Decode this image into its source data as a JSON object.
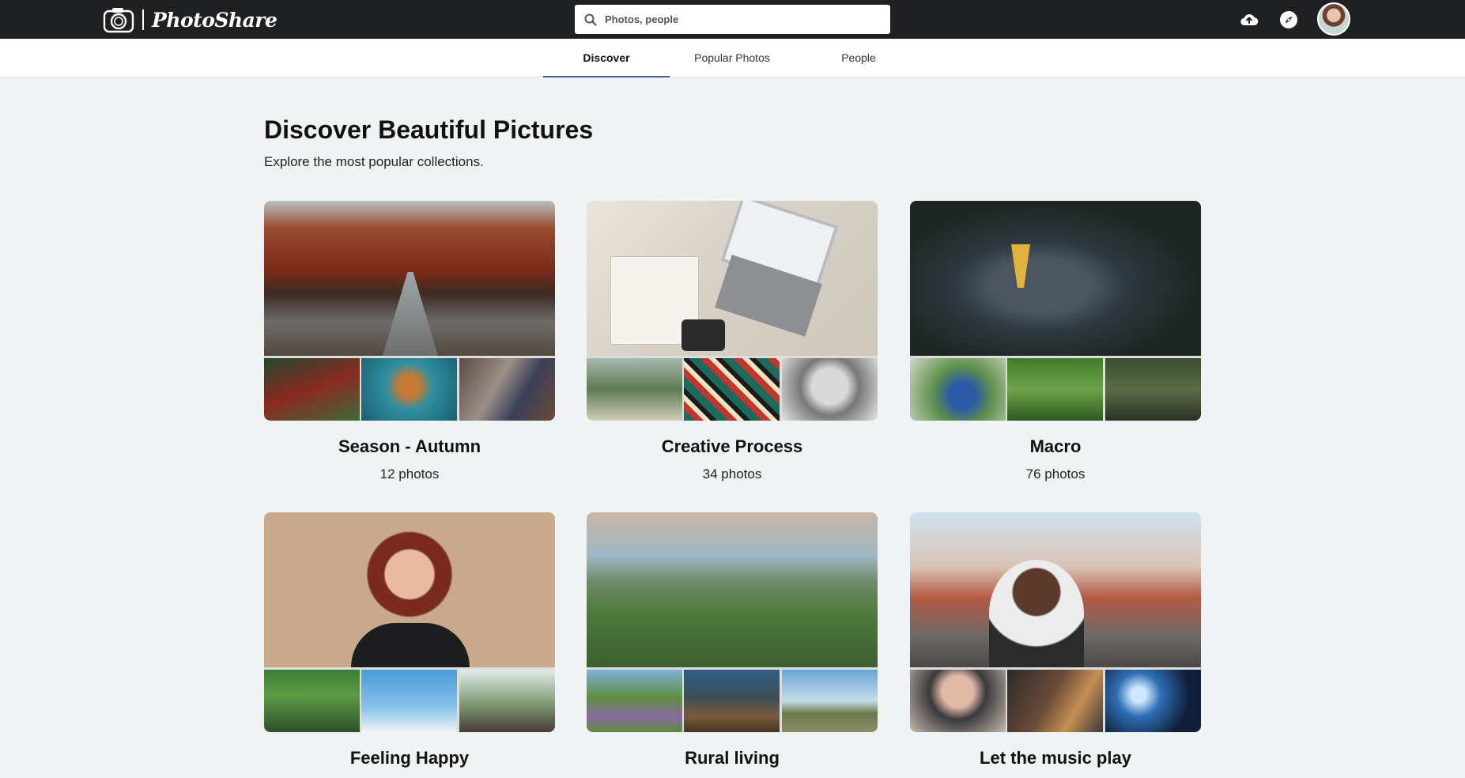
{
  "header": {
    "brand": "PhotoShare",
    "search_placeholder": "Photos, people",
    "icons": [
      "camera-logo-icon",
      "search-icon",
      "upload-cloud-icon",
      "compass-icon"
    ]
  },
  "tabs": [
    {
      "label": "Discover",
      "active": true
    },
    {
      "label": "Popular Photos",
      "active": false
    },
    {
      "label": "People",
      "active": false
    }
  ],
  "page": {
    "title": "Discover Beautiful Pictures",
    "subtitle": "Explore the most popular collections."
  },
  "collections": [
    {
      "title": "Season - Autumn",
      "count": "12 photos"
    },
    {
      "title": "Creative Process",
      "count": "34 photos"
    },
    {
      "title": "Macro",
      "count": "76 photos"
    },
    {
      "title": "Feeling Happy",
      "count": ""
    },
    {
      "title": "Rural living",
      "count": ""
    },
    {
      "title": "Let the music play",
      "count": ""
    }
  ],
  "colors": {
    "topbar": "#1f2022",
    "background": "#f0f3f4",
    "active_tab_underline": "#4a5b8a"
  }
}
